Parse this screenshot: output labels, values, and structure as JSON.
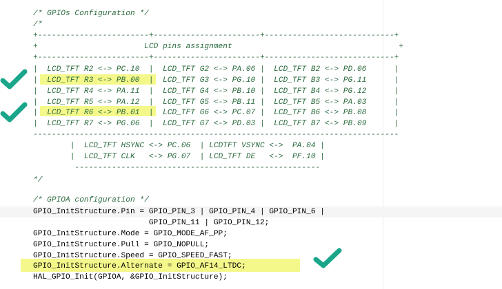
{
  "colors": {
    "comment": "#2c6b3f",
    "code": "#000000",
    "highlight": "#f4f88a",
    "current_line": "#f5f5f5",
    "check": "#1aa68a"
  },
  "icons": [
    "checkmark-icon"
  ],
  "lines": [
    {
      "text": "/* GPIOs Configuration */",
      "kind": "comment"
    },
    {
      "text": "/*",
      "kind": "comment"
    },
    {
      "text": "+------------------------+-----------------------+----------------------------+",
      "kind": "comment"
    },
    {
      "text": "+                       LCD pins assignment                                    +",
      "kind": "comment"
    },
    {
      "text": "+------------------------+-----------------------+----------------------------+",
      "kind": "comment"
    },
    {
      "text": "|  LCD_TFT R2 <-> PC.10  |  LCD_TFT G2 <-> PA.06 |  LCD_TFT B2 <-> PD.06      |",
      "kind": "comment"
    },
    {
      "text": "|  LCD_TFT R3 <-> PB.00  |  LCD_TFT G3 <-> PG.10 |  LCD_TFT B3 <-> PG.11      |",
      "kind": "comment"
    },
    {
      "text": "|  LCD_TFT R4 <-> PA.11  |  LCD_TFT G4 <-> PB.10 |  LCD_TFT B4 <-> PG.12      |",
      "kind": "comment"
    },
    {
      "text": "|  LCD_TFT R5 <-> PA.12  |  LCD_TFT G5 <-> PB.11 |  LCD_TFT B5 <-> PA.03      |",
      "kind": "comment"
    },
    {
      "text": "|  LCD_TFT R6 <-> PB.01  |  LCD_TFT G6 <-> PC.07 |  LCD_TFT B6 <-> PB.08      |",
      "kind": "comment"
    },
    {
      "text": "|  LCD_TFT R7 <-> PG.06  |  LCD_TFT G7 <-> PD.03 |  LCD_TFT B7 <-> PB.09      |",
      "kind": "comment"
    },
    {
      "text": "-------------------------------------------------------------------------------",
      "kind": "comment"
    },
    {
      "text": "        |  LCD_TFT HSYNC <-> PC.06  | LCDTFT VSYNC <->  PA.04 |",
      "kind": "comment"
    },
    {
      "text": "        |  LCD_TFT CLK   <-> PG.07  | LCD_TFT DE   <->  PF.10 |",
      "kind": "comment"
    },
    {
      "text": "         -----------------------------------------------------",
      "kind": "comment"
    },
    {
      "text": "",
      "kind": "blank"
    },
    {
      "text": "*/",
      "kind": "comment"
    },
    {
      "text": "",
      "kind": "blank"
    },
    {
      "text": "/* GPIOA configuration */",
      "kind": "comment"
    },
    {
      "text": "GPIO_InitStructure.Pin = GPIO_PIN_3 | GPIO_PIN_4 | GPIO_PIN_6 |",
      "kind": "code"
    },
    {
      "text": "                         GPIO_PIN_11 | GPIO_PIN_12;",
      "kind": "code"
    },
    {
      "text": "GPIO_InitStructure.Mode = GPIO_MODE_AF_PP;",
      "kind": "code"
    },
    {
      "text": "GPIO_InitStructure.Pull = GPIO_NOPULL;",
      "kind": "code"
    },
    {
      "text": "GPIO_InitStructure.Speed = GPIO_SPEED_FAST;",
      "kind": "code"
    },
    {
      "text": "GPIO_InitStructure.Alternate = GPIO_AF14_LTDC;",
      "kind": "code"
    },
    {
      "text": "HAL_GPIO_Init(GPIOA, &GPIO_InitStructure);",
      "kind": "code"
    }
  ]
}
